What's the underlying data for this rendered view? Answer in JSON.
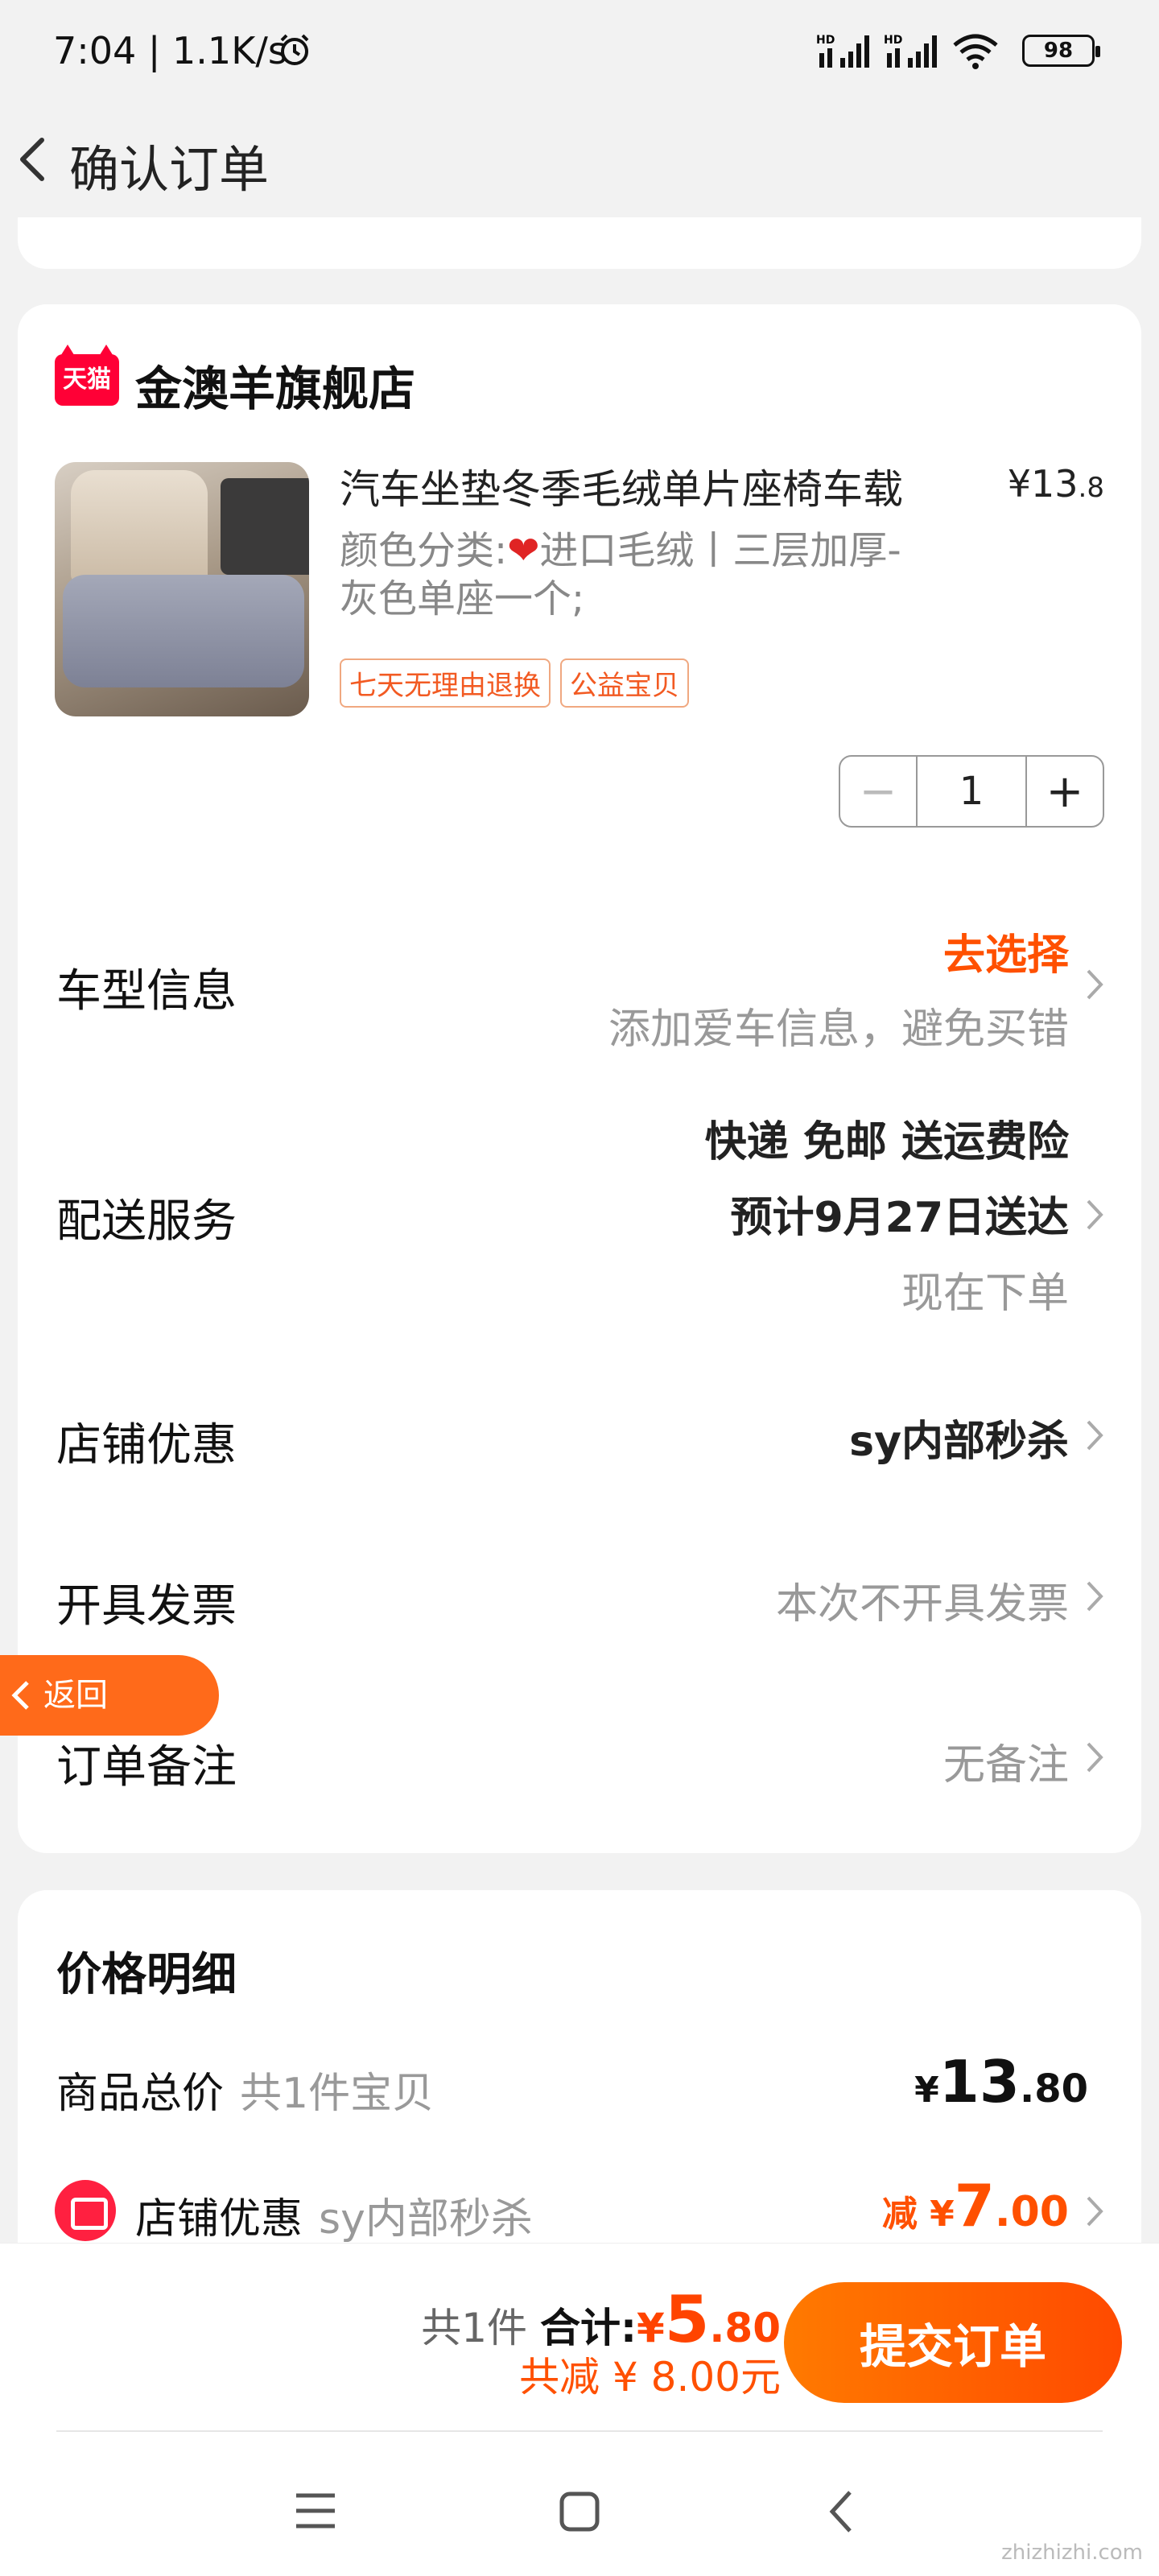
{
  "status": {
    "time": "7:04 | 1.1K/s",
    "network": "HD",
    "battery": "98"
  },
  "header": {
    "title": "确认订单"
  },
  "store": {
    "logo_text": "天猫",
    "name": "金澳羊旗舰店",
    "product": {
      "title": "汽车坐垫冬季毛绒单片座椅车载",
      "price_main": "¥13",
      "price_decimal": ".8",
      "spec_prefix": "颜色分类:",
      "spec_rest": "进口毛绒丨三层加厚-灰色单座一个;",
      "tags": [
        "七天无理由退换",
        "公益宝贝"
      ],
      "quantity": "1"
    },
    "rows": {
      "car_label": "车型信息",
      "car_action": "去选择",
      "car_hint": "添加爱车信息，避免买错",
      "delivery_label": "配送服务",
      "delivery_line1": "快递 免邮 送运费险",
      "delivery_line2": "预计9月27日送达",
      "delivery_line3": "现在下单",
      "coupon_label": "店铺优惠",
      "coupon_value": "sy内部秒杀",
      "invoice_label": "开具发票",
      "invoice_value": "本次不开具发票",
      "note_label": "订单备注",
      "note_value": "无备注"
    }
  },
  "float_back": {
    "label": "返回"
  },
  "price_detail": {
    "title": "价格明细",
    "total_label": "商品总价",
    "total_sub": "共1件宝贝",
    "total_currency": "¥",
    "total_int": "13",
    "total_dec": ".80",
    "coupon_label": "店铺优惠",
    "coupon_sub": "sy内部秒杀",
    "coupon_prefix": "减 ¥",
    "coupon_int": "7",
    "coupon_dec": ".00"
  },
  "bottom": {
    "count": "共1件",
    "sum_label": "合计:",
    "currency": "¥",
    "sum_int": "5",
    "sum_dec": ".80",
    "discount": "共减 ¥ 8.00元",
    "submit": "提交订单"
  },
  "watermark": "zhizhizhi.com"
}
